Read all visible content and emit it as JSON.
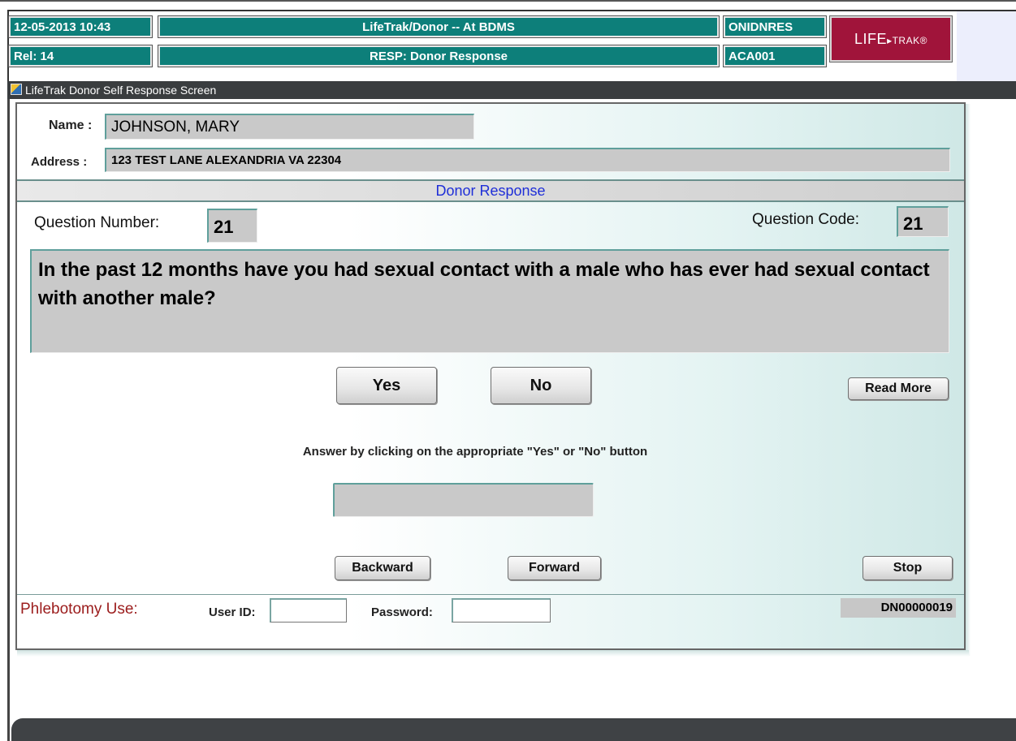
{
  "header": {
    "datetime": "12-05-2013  10:43",
    "release": "Rel: 14",
    "app_title": "LifeTrak/Donor -- At BDMS",
    "function": "RESP: Donor Response",
    "code1": "ONIDNRES",
    "code2": "ACA001",
    "logo_text": "LIFE",
    "logo_suffix": "▸TRAK®"
  },
  "window": {
    "title": "LifeTrak Donor Self Response Screen"
  },
  "donor": {
    "name_label": "Name :",
    "name_value": "JOHNSON, MARY",
    "address_label": "Address :",
    "address_value": "123 TEST LANE  ALEXANDRIA VA 22304"
  },
  "section": {
    "title": "Donor Response"
  },
  "question": {
    "number_label": "Question Number:",
    "number_value": "21",
    "code_label": "Question Code:",
    "code_value": "21",
    "text": "In the past 12 months have you had sexual contact with a male who has ever had sexual contact with another male?"
  },
  "buttons": {
    "yes": "Yes",
    "no": "No",
    "read_more": "Read More",
    "backward": "Backward",
    "forward": "Forward",
    "stop": "Stop"
  },
  "instruction": "Answer by clicking on the appropriate \"Yes\"  or  \"No\" button",
  "answer_value": "",
  "phlebotomy": {
    "label": "Phlebotomy Use:",
    "user_label": "User ID:",
    "user_value": "",
    "password_label": "Password:",
    "password_value": "",
    "donor_id": "DN00000019"
  },
  "colors": {
    "header_teal": "#0d7f7a",
    "logo_red": "#a0143a",
    "section_title_blue": "#1f2fd8",
    "phlebotomy_red": "#9b1c1c"
  }
}
